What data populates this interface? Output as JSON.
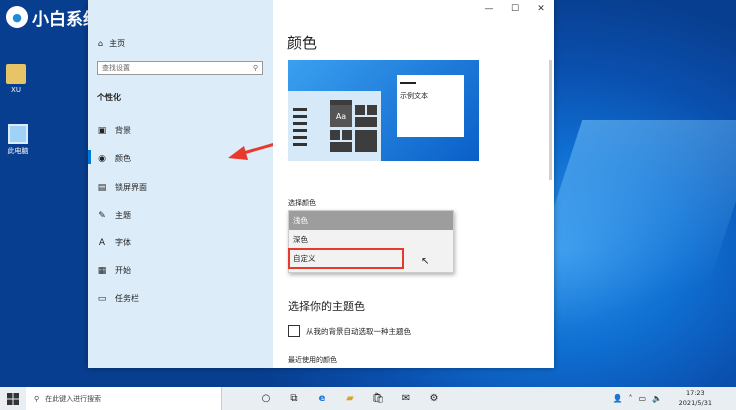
{
  "brand": {
    "name": "小白系统",
    "mark": "●"
  },
  "desktop_icons": [
    {
      "label": "XU"
    },
    {
      "label": "此电脑"
    }
  ],
  "window_controls": {
    "minimize": "—",
    "maximize": "☐",
    "close": "✕"
  },
  "sidebar": {
    "home_label": "主页",
    "search_placeholder": "查找设置",
    "section": "个性化",
    "items": [
      {
        "label": "背景",
        "icon": "background-icon",
        "glyph": "▣"
      },
      {
        "label": "颜色",
        "icon": "palette-icon",
        "glyph": "◉"
      },
      {
        "label": "锁屏界面",
        "icon": "lockscreen-icon",
        "glyph": "▤"
      },
      {
        "label": "主题",
        "icon": "theme-icon",
        "glyph": "✎"
      },
      {
        "label": "字体",
        "icon": "font-icon",
        "glyph": "A"
      },
      {
        "label": "开始",
        "icon": "start-icon",
        "glyph": "▦"
      },
      {
        "label": "任务栏",
        "icon": "taskbar-icon",
        "glyph": "▭"
      }
    ]
  },
  "main": {
    "title": "颜色",
    "preview_text": "示例文本",
    "preview_tile_text": "Aa",
    "pick_color_label": "选择颜色",
    "dropdown_options": [
      "浅色",
      "深色",
      "自定义"
    ],
    "selected_option": "浅色",
    "highlighted_option": "自定义",
    "accent_heading": "选择你的主题色",
    "auto_accent_label": "从我的背景自动选取一种主题色",
    "recent_colors_label": "最近使用的颜色"
  },
  "taskbar": {
    "search_placeholder": "在此键入进行搜索",
    "time": "17:23",
    "date": "2021/5/31"
  },
  "colors": {
    "accent": "#0078d7",
    "highlight_box": "#e8392d",
    "arrow": "#e8392d"
  }
}
